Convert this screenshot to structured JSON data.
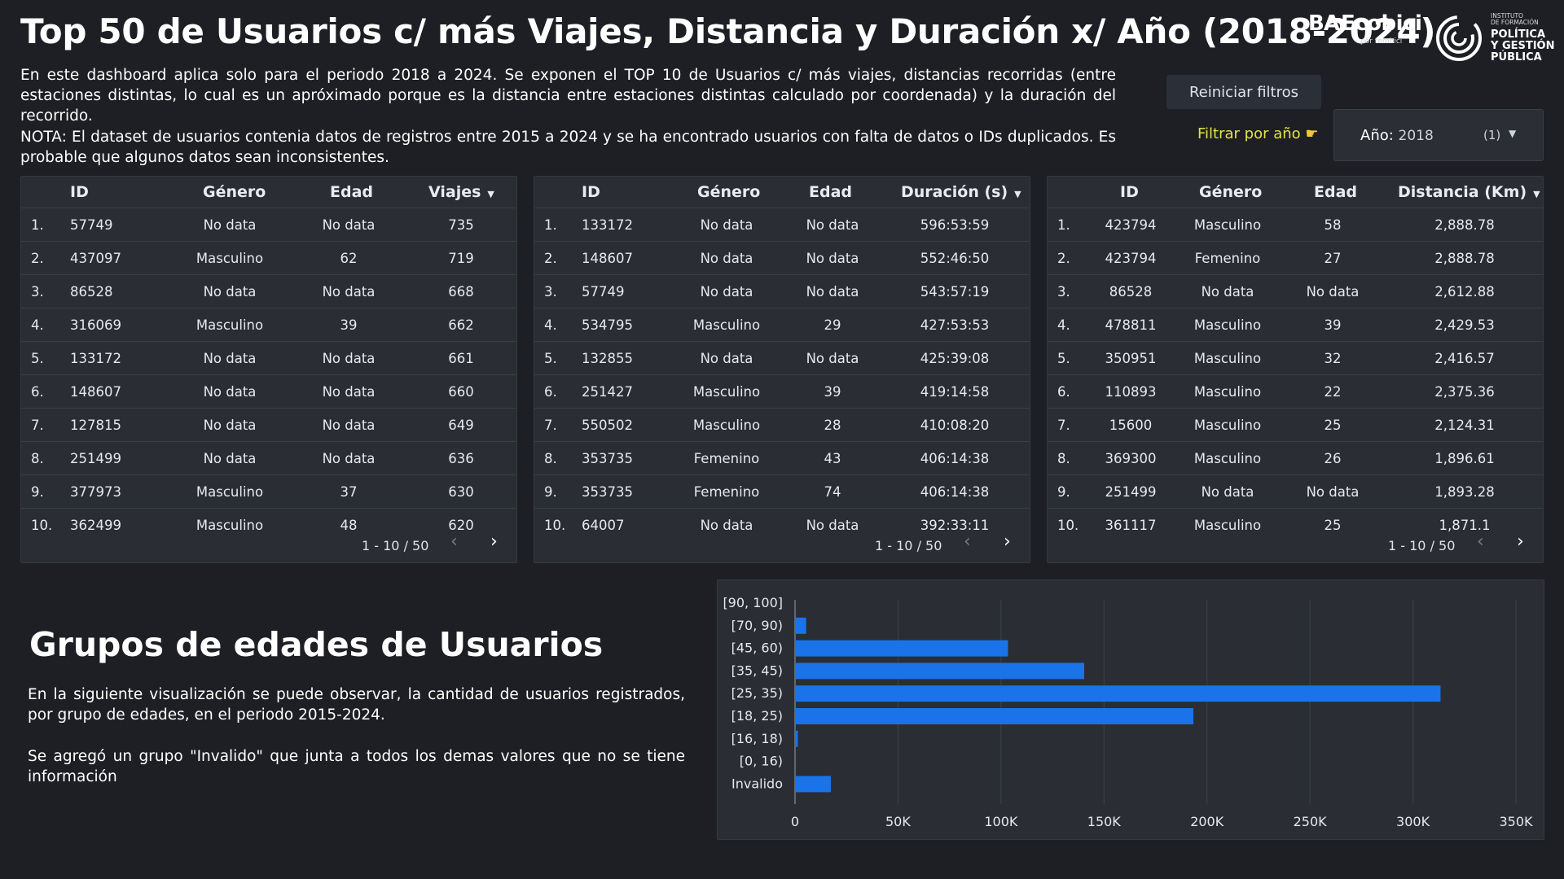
{
  "title": "Top 50 de Usuarios c/ más Viajes, Distancia y Duración x/ Año (2018-2024)",
  "description_1": "En este dashboard aplica solo para el periodo 2018 a 2024. Se exponen el TOP 10 de Usuarios c/ más viajes, distancias recorridas (entre estaciones distintas, lo cual es un apróximado porque es la distancia entre estaciones distintas calculado por coordenada) y la duración del recorrido.",
  "description_2": "NOTA: El dataset de usuarios contenia datos de registros entre 2015 a 2024 y se ha encontrado usuarios con falta de datos o IDs duplicados. Es probable que algunos datos sean inconsistentes.",
  "logos": {
    "ba": "BA",
    "ecobici": "Ecobici",
    "por": "por tembici",
    "inst_small": "INSTITUTO\nDE FORMACIÓN",
    "inst_big": "POLÍTICA\nY GESTIÓN\nPÚBLICA"
  },
  "controls": {
    "reset_label": "Reiniciar filtros",
    "filter_label": "Filtrar por año",
    "filter_icon": "pointing-hand-icon",
    "year_label": "Año:",
    "year_value": "2018",
    "year_count": "(1)"
  },
  "tables": [
    {
      "columns": [
        "ID",
        "Género",
        "Edad",
        "Viajes"
      ],
      "rows": [
        [
          "1.",
          "57749",
          "No data",
          "No data",
          "735"
        ],
        [
          "2.",
          "437097",
          "Masculino",
          "62",
          "719"
        ],
        [
          "3.",
          "86528",
          "No data",
          "No data",
          "668"
        ],
        [
          "4.",
          "316069",
          "Masculino",
          "39",
          "662"
        ],
        [
          "5.",
          "133172",
          "No data",
          "No data",
          "661"
        ],
        [
          "6.",
          "148607",
          "No data",
          "No data",
          "660"
        ],
        [
          "7.",
          "127815",
          "No data",
          "No data",
          "649"
        ],
        [
          "8.",
          "251499",
          "No data",
          "No data",
          "636"
        ],
        [
          "9.",
          "377973",
          "Masculino",
          "37",
          "630"
        ],
        [
          "10.",
          "362499",
          "Masculino",
          "48",
          "620"
        ]
      ],
      "pager": "1 - 10 / 50"
    },
    {
      "columns": [
        "ID",
        "Género",
        "Edad",
        "Duración (s)"
      ],
      "rows": [
        [
          "1.",
          "133172",
          "No data",
          "No data",
          "596:53:59"
        ],
        [
          "2.",
          "148607",
          "No data",
          "No data",
          "552:46:50"
        ],
        [
          "3.",
          "57749",
          "No data",
          "No data",
          "543:57:19"
        ],
        [
          "4.",
          "534795",
          "Masculino",
          "29",
          "427:53:53"
        ],
        [
          "5.",
          "132855",
          "No data",
          "No data",
          "425:39:08"
        ],
        [
          "6.",
          "251427",
          "Masculino",
          "39",
          "419:14:58"
        ],
        [
          "7.",
          "550502",
          "Masculino",
          "28",
          "410:08:20"
        ],
        [
          "8.",
          "353735",
          "Femenino",
          "43",
          "406:14:38"
        ],
        [
          "9.",
          "353735",
          "Femenino",
          "74",
          "406:14:38"
        ],
        [
          "10.",
          "64007",
          "No data",
          "No data",
          "392:33:11"
        ]
      ],
      "pager": "1 - 10 / 50"
    },
    {
      "columns": [
        "ID",
        "Género",
        "Edad",
        "Distancia (Km)"
      ],
      "rows": [
        [
          "1.",
          "423794",
          "Masculino",
          "58",
          "2,888.78"
        ],
        [
          "2.",
          "423794",
          "Femenino",
          "27",
          "2,888.78"
        ],
        [
          "3.",
          "86528",
          "No data",
          "No data",
          "2,612.88"
        ],
        [
          "4.",
          "478811",
          "Masculino",
          "39",
          "2,429.53"
        ],
        [
          "5.",
          "350951",
          "Masculino",
          "32",
          "2,416.57"
        ],
        [
          "6.",
          "110893",
          "Masculino",
          "22",
          "2,375.36"
        ],
        [
          "7.",
          "15600",
          "Masculino",
          "25",
          "2,124.31"
        ],
        [
          "8.",
          "369300",
          "Masculino",
          "26",
          "1,896.61"
        ],
        [
          "9.",
          "251499",
          "No data",
          "No data",
          "1,893.28"
        ],
        [
          "10.",
          "361117",
          "Masculino",
          "25",
          "1,871.1"
        ]
      ],
      "pager": "1 - 10 / 50"
    }
  ],
  "section": {
    "title": "Grupos de edades de Usuarios",
    "desc_1": "En la siguiente visualización se puede observar, la cantidad de usuarios registrados, por grupo de edades, en el periodo 2015-2024.",
    "desc_2": "Se agregó un grupo \"Invalido\" que junta a todos los demas valores que no se tiene información"
  },
  "chart_data": {
    "type": "bar",
    "orientation": "horizontal",
    "categories": [
      "[90, 100]",
      "[70, 90)",
      "[45, 60)",
      "[35, 45)",
      "[25, 35)",
      "[18, 25)",
      "[16, 18)",
      "[0, 16)",
      "Invalido"
    ],
    "values": [
      0,
      5000,
      103000,
      140000,
      313000,
      193000,
      1000,
      0,
      17000
    ],
    "x_ticks": [
      "0",
      "50K",
      "100K",
      "150K",
      "200K",
      "250K",
      "300K",
      "350K"
    ],
    "xlim": [
      0,
      350000
    ],
    "grid": true,
    "bar_color": "#1a73e8"
  }
}
